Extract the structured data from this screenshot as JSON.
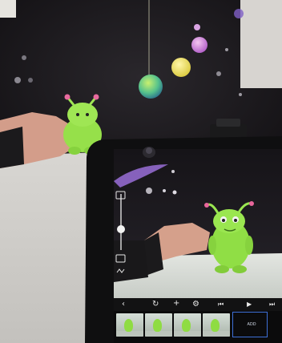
{
  "photo": {
    "subject": "green clay monster figure filmed by a tablet stop-motion app",
    "app_toolbar_icons": [
      "back-icon",
      "sync-icon",
      "add-icon",
      "gear-icon",
      "skip-back-icon",
      "play-icon",
      "skip-forward-icon"
    ],
    "timeline_frame_count": 5,
    "timeline_caption": "ADD"
  },
  "colors": {
    "backdrop": "#141215",
    "clay_green": "#8fdc43",
    "tablet_bezel": "#0f0f10",
    "selection_outline": "#3e6fd6"
  }
}
